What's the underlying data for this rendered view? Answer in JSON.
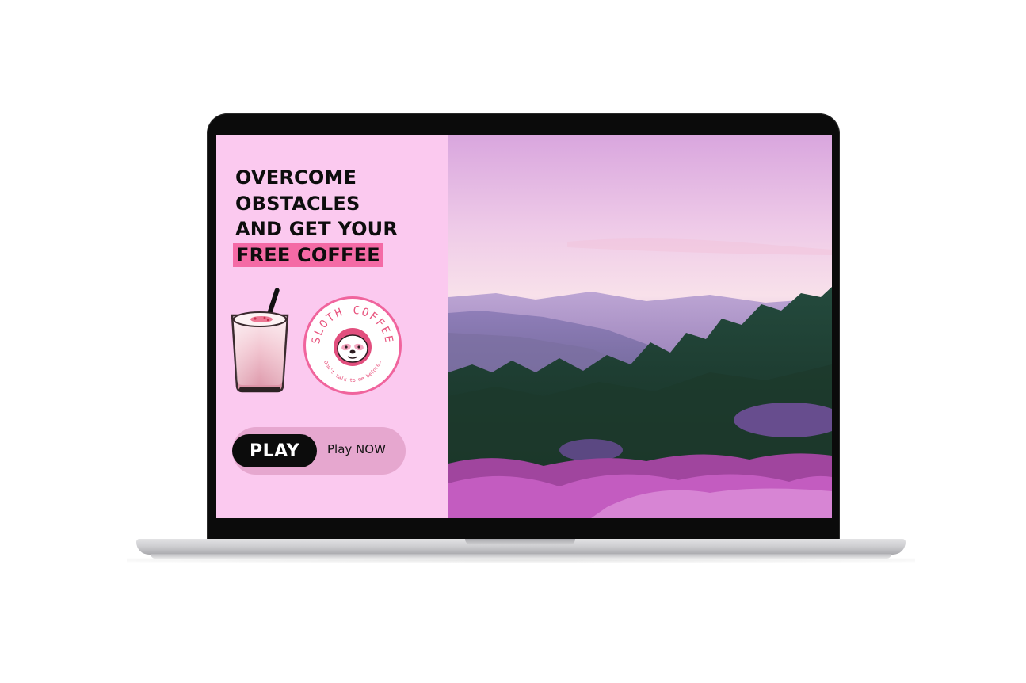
{
  "promo": {
    "headline_lines": [
      "OVERCOME",
      "OBSTACLES",
      "AND GET YOUR"
    ],
    "headline_highlight": "FREE COFFEE",
    "highlight_color": "#f46aa5",
    "panel_color": "#fbc9ef"
  },
  "logo": {
    "brand_top": "SLOTH COFFEE",
    "tagline": "Don't talk to me before…"
  },
  "cta": {
    "play_label": "PLAY",
    "secondary_label": "Play NOW"
  },
  "icons": [
    "iced-drink-icon",
    "sloth-face-icon"
  ]
}
